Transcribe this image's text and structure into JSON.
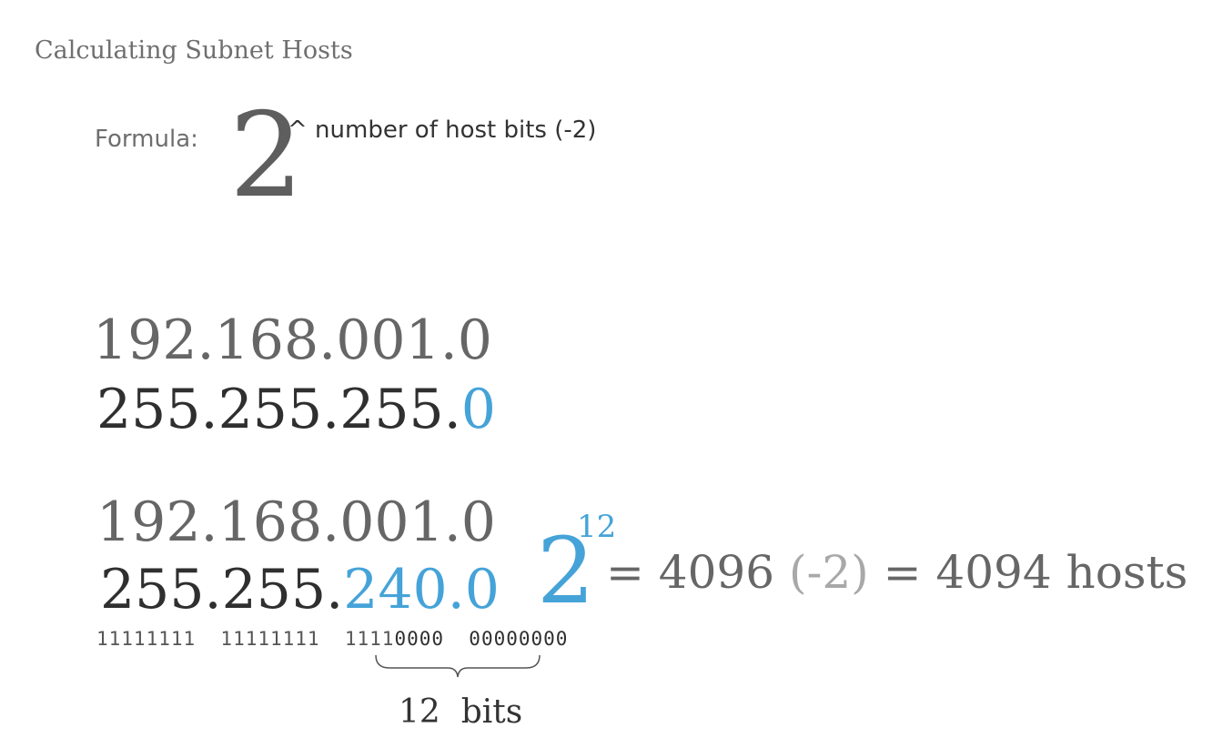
{
  "title": "Calculating Subnet Hosts",
  "formula": {
    "label": "Formula:",
    "base": "2",
    "exponent": "^ number of host bits (-2)"
  },
  "example1": {
    "ip": "192.168.001.0",
    "mask_prefix": "255.255.255.",
    "mask_host": "0"
  },
  "example2": {
    "ip": "192.168.001.0",
    "mask_prefix": "255.255.",
    "mask_host": "240.0",
    "binary_network": "11111111  11111111  1111",
    "binary_host": "0000  00000000",
    "host_bits_label": "12  bits"
  },
  "result": {
    "base": "2",
    "exponent": "12",
    "equals1": "= 4096",
    "minus": "(-2)",
    "equals2": "= 4094 hosts"
  },
  "colors": {
    "accent": "#45a3d8",
    "text_gray": "#666666",
    "text_dark": "#2f2f2f",
    "text_light": "#a8a8a8"
  }
}
